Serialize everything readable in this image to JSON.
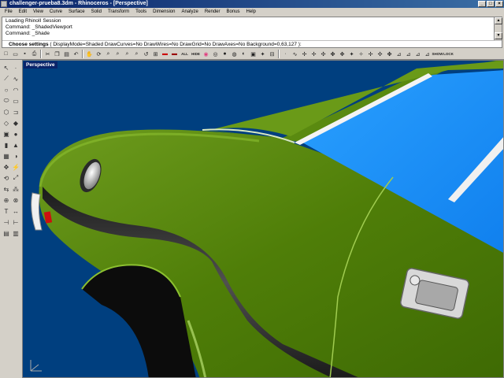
{
  "window": {
    "title": "challenger-prueba8.3dm - Rhinoceros - [Perspective]"
  },
  "menu": [
    "File",
    "Edit",
    "View",
    "Curve",
    "Surface",
    "Solid",
    "Transform",
    "Tools",
    "Dimension",
    "Analyze",
    "Render",
    "Bonus",
    "Help"
  ],
  "command": {
    "history": [
      "Loading RhinoII Session",
      "Command: _ShadedViewport",
      "Command: _Shade"
    ],
    "prompt_label": "Choose settings",
    "prompt_options": "( DisplayMode=Shaded  DrawCurves=No  DrawWires=No  DrawGrid=No  DrawAxes=No  Background=0,63,127 ):"
  },
  "toolbar": {
    "all_label": "ALL",
    "hide_label": "HIDE",
    "show_label": "SHOW",
    "lock_label": "LOCK"
  },
  "viewport": {
    "title": "Perspective",
    "background": "#003f7f",
    "body_color": "#5c8a0e",
    "glass_color": "#1a8fff"
  },
  "colors": {
    "window_bg": "#d4d0c8",
    "title_active": "#0a246a"
  }
}
